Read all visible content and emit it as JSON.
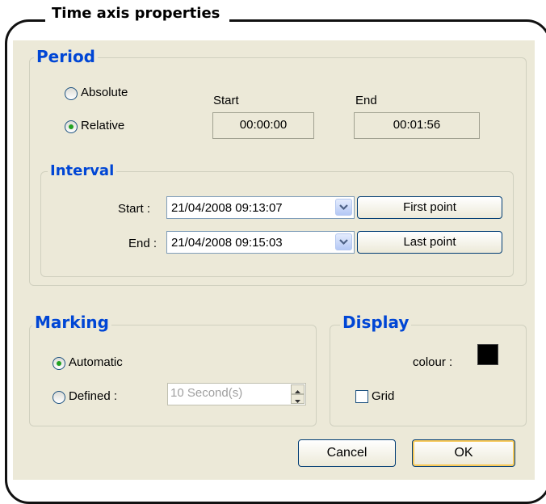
{
  "window": {
    "title": "Time axis properties"
  },
  "period": {
    "title": "Period",
    "options": [
      {
        "label": "Absolute",
        "selected": false
      },
      {
        "label": "Relative",
        "selected": true
      }
    ],
    "start_label": "Start",
    "end_label": "End",
    "start_value": "00:00:00",
    "end_value": "00:01:56"
  },
  "interval": {
    "title": "Interval",
    "start_label": "Start :",
    "start_value": "21/04/2008 09:13:07",
    "end_label": "End :",
    "end_value": "21/04/2008 09:15:03",
    "first_button": "First point",
    "last_button": "Last point"
  },
  "marking": {
    "title": "Marking",
    "automatic_label": "Automatic",
    "defined_label": "Defined :",
    "selected": "Automatic",
    "defined_value": "10 Second(s)"
  },
  "display": {
    "title": "Display",
    "colour_label": "colour :",
    "colour": "#000000",
    "grid_label": "Grid",
    "grid_checked": false
  },
  "buttons": {
    "cancel": "Cancel",
    "ok": "OK"
  }
}
